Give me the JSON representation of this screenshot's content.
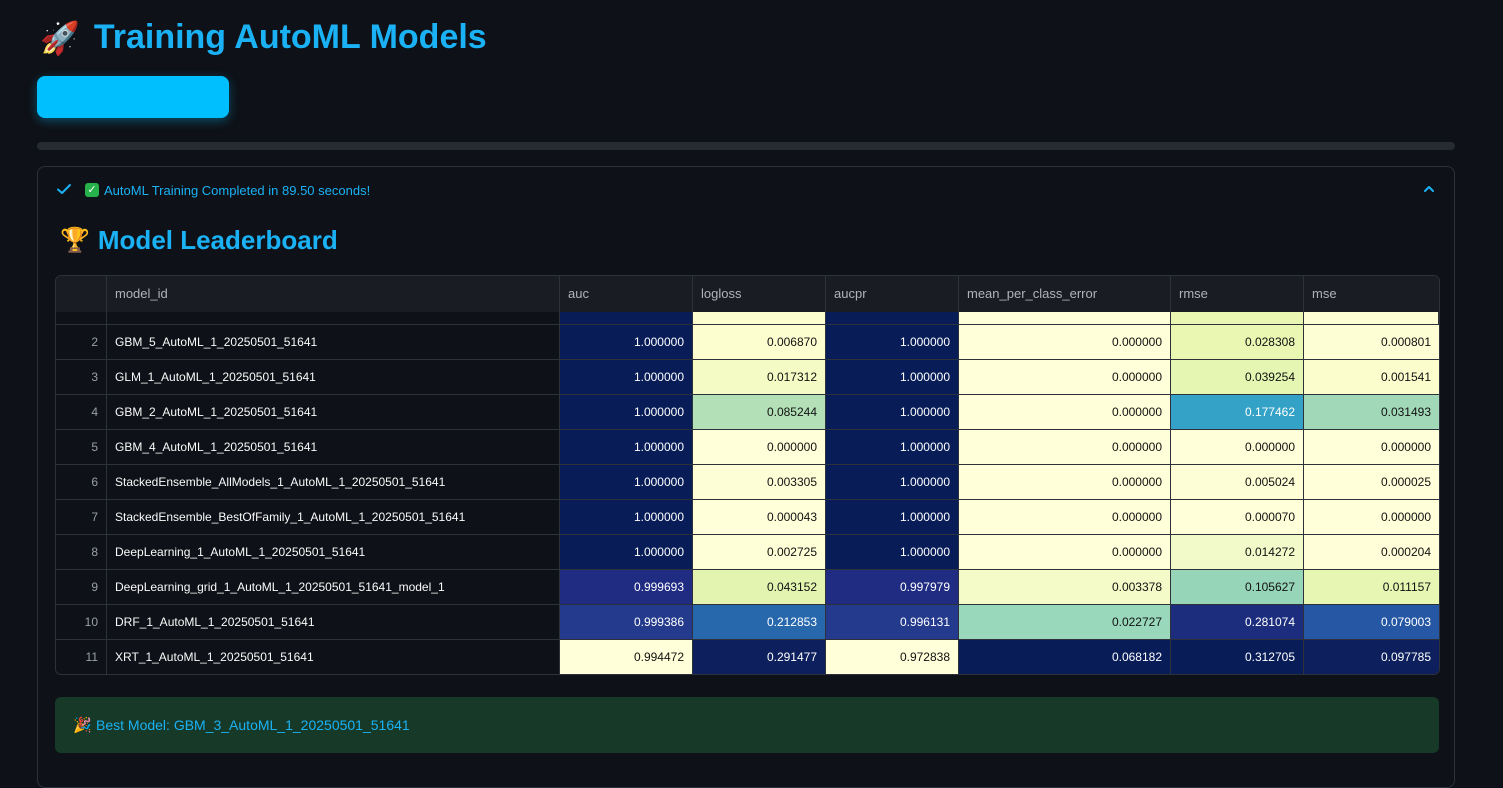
{
  "header": {
    "icon": "rocket-icon",
    "title": "Training AutoML Models"
  },
  "action_button": {
    "label": "",
    "color": "#00bfff"
  },
  "expander": {
    "status_text": "AutoML Training Completed in 89.50 seconds!",
    "status_icon": "check-mark-icon",
    "expanded": true
  },
  "leaderboard": {
    "icon": "trophy-icon",
    "title": "Model Leaderboard",
    "columns": [
      "",
      "model_id",
      "auc",
      "logloss",
      "aucpr",
      "mean_per_class_error",
      "rmse",
      "mse"
    ],
    "rows": [
      {
        "idx": "2",
        "model_id": "GBM_5_AutoML_1_20250501_51641",
        "auc": "1.000000",
        "logloss": "0.006870",
        "aucpr": "1.000000",
        "mpce": "0.000000",
        "rmse": "0.028308",
        "mse": "0.000801"
      },
      {
        "idx": "3",
        "model_id": "GLM_1_AutoML_1_20250501_51641",
        "auc": "1.000000",
        "logloss": "0.017312",
        "aucpr": "1.000000",
        "mpce": "0.000000",
        "rmse": "0.039254",
        "mse": "0.001541"
      },
      {
        "idx": "4",
        "model_id": "GBM_2_AutoML_1_20250501_51641",
        "auc": "1.000000",
        "logloss": "0.085244",
        "aucpr": "1.000000",
        "mpce": "0.000000",
        "rmse": "0.177462",
        "mse": "0.031493"
      },
      {
        "idx": "5",
        "model_id": "GBM_4_AutoML_1_20250501_51641",
        "auc": "1.000000",
        "logloss": "0.000000",
        "aucpr": "1.000000",
        "mpce": "0.000000",
        "rmse": "0.000000",
        "mse": "0.000000"
      },
      {
        "idx": "6",
        "model_id": "StackedEnsemble_AllModels_1_AutoML_1_20250501_51641",
        "auc": "1.000000",
        "logloss": "0.003305",
        "aucpr": "1.000000",
        "mpce": "0.000000",
        "rmse": "0.005024",
        "mse": "0.000025"
      },
      {
        "idx": "7",
        "model_id": "StackedEnsemble_BestOfFamily_1_AutoML_1_20250501_51641",
        "auc": "1.000000",
        "logloss": "0.000043",
        "aucpr": "1.000000",
        "mpce": "0.000000",
        "rmse": "0.000070",
        "mse": "0.000000"
      },
      {
        "idx": "8",
        "model_id": "DeepLearning_1_AutoML_1_20250501_51641",
        "auc": "1.000000",
        "logloss": "0.002725",
        "aucpr": "1.000000",
        "mpce": "0.000000",
        "rmse": "0.014272",
        "mse": "0.000204"
      },
      {
        "idx": "9",
        "model_id": "DeepLearning_grid_1_AutoML_1_20250501_51641_model_1",
        "auc": "0.999693",
        "logloss": "0.043152",
        "aucpr": "0.997979",
        "mpce": "0.003378",
        "rmse": "0.105627",
        "mse": "0.011157"
      },
      {
        "idx": "10",
        "model_id": "DRF_1_AutoML_1_20250501_51641",
        "auc": "0.999386",
        "logloss": "0.212853",
        "aucpr": "0.996131",
        "mpce": "0.022727",
        "rmse": "0.281074",
        "mse": "0.079003"
      },
      {
        "idx": "11",
        "model_id": "XRT_1_AutoML_1_20250501_51641",
        "auc": "0.994472",
        "logloss": "0.291477",
        "aucpr": "0.972838",
        "mpce": "0.068182",
        "rmse": "0.312705",
        "mse": "0.097785"
      }
    ],
    "cell_colors": [
      [
        "#081d58",
        "#fdfed0",
        "#081d58",
        "#ffffd9",
        "#e9f7b3",
        "#fefed5"
      ],
      [
        "#081d58",
        "#f5fbc4",
        "#081d58",
        "#ffffd9",
        "#e5f5b2",
        "#fcfdcd"
      ],
      [
        "#081d58",
        "#b3e0b6",
        "#081d58",
        "#ffffd9",
        "#33a2c6",
        "#a1d9b8"
      ],
      [
        "#081d58",
        "#ffffd9",
        "#081d58",
        "#ffffd9",
        "#ffffd9",
        "#ffffd9"
      ],
      [
        "#081d58",
        "#fefed6",
        "#081d58",
        "#ffffd9",
        "#fdfed6",
        "#ffffd9"
      ],
      [
        "#081d58",
        "#ffffd9",
        "#081d58",
        "#ffffd9",
        "#ffffd9",
        "#ffffd9"
      ],
      [
        "#081d58",
        "#fefed7",
        "#081d58",
        "#ffffd9",
        "#f3faca",
        "#fffed8"
      ],
      [
        "#1f2c82",
        "#e3f4b1",
        "#1f2c82",
        "#f4fbc8",
        "#96d5b8",
        "#e8f6b3"
      ],
      [
        "#243a8c",
        "#2768ad",
        "#243a8c",
        "#9ad8bc",
        "#1c2d7e",
        "#2557a4"
      ],
      [
        "#ffffd9",
        "#0d1f5c",
        "#ffffd9",
        "#081d58",
        "#081d58",
        "#0d1f5c"
      ]
    ]
  },
  "best_model": {
    "icon": "party-popper-icon",
    "text": "Best Model: GBM_3_AutoML_1_20250501_51641"
  }
}
